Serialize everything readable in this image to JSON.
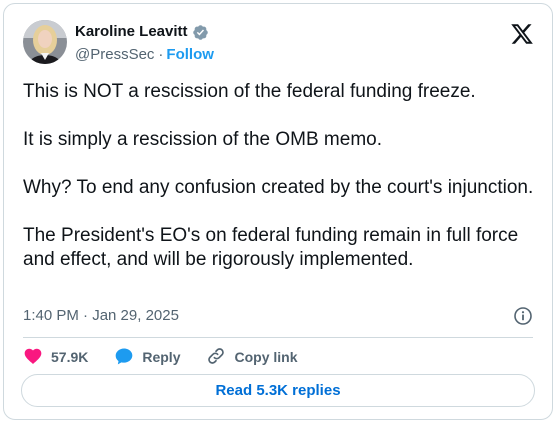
{
  "author": {
    "name": "Karoline Leavitt",
    "handle": "@PressSec",
    "separator": "·",
    "follow_label": "Follow"
  },
  "tweet": {
    "paragraphs": [
      "This is NOT a rescission of the federal funding freeze.",
      "It is simply a rescission of the OMB memo.",
      "Why? To end any confusion created by the court's injunction.",
      "The President's EO's on federal funding remain in full force and effect, and will be rigorously implemented."
    ],
    "time": "1:40 PM · Jan 29, 2025"
  },
  "actions": {
    "likes": "57.9K",
    "reply_label": "Reply",
    "copy_link_label": "Copy link"
  },
  "replies_button": "Read 5.3K replies",
  "icons": {
    "verified": "verified-badge-icon",
    "platform": "x-logo-icon",
    "info": "info-icon",
    "like": "heart-icon",
    "reply": "reply-bubble-icon",
    "copy": "link-icon"
  },
  "colors": {
    "accent": "#1d9bf0",
    "like": "#f91880",
    "text": "#0f1419",
    "muted": "#536471",
    "border": "#cfd9de"
  }
}
